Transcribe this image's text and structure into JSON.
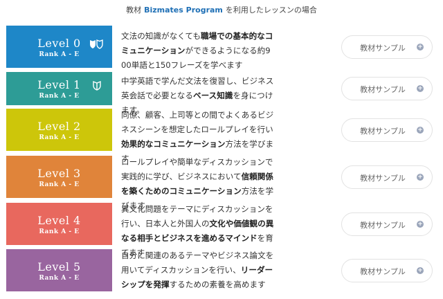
{
  "heading": {
    "prefix": "教材",
    "brand": "Bizmates Program",
    "suffix": "を利用したレッスンの場合"
  },
  "levels": [
    {
      "level": "Level 0",
      "rank": "Rank A - E",
      "color": "#1e87c8",
      "desc": [
        [
          "文法の知識がなくても"
        ],
        [
          "職場での基本的なコミュニケーション",
          true
        ],
        [
          "ができるようになる約900単語と150フレーズを学べます"
        ]
      ],
      "button": "教材サンプル",
      "icon": "double-shield-icon"
    },
    {
      "level": "Level 1",
      "rank": "Rank A - E",
      "color": "#2d9c96",
      "desc": [
        [
          "中学英語で学んだ文法を復習し、ビジネス英会話で必要となる"
        ],
        [
          "ベース知識",
          true
        ],
        [
          "を身につけます。"
        ]
      ],
      "button": "教材サンプル",
      "icon": "shield-icon"
    },
    {
      "level": "Level 2",
      "rank": "Rank A - E",
      "color": "#cdc60a",
      "desc": [
        [
          "同僚、顧客、上司等との間でよくあるビジネスシーンを想定したロールプレイを行い"
        ],
        [
          "効果的なコミュニケーション",
          true
        ],
        [
          "方法を学びます"
        ]
      ],
      "button": "教材サンプル"
    },
    {
      "level": "Level 3",
      "rank": "Rank A - E",
      "color": "#e0843a",
      "desc": [
        [
          "ロールプレイや簡単なディスカッションで実践的に学び、ビジネスにおいて"
        ],
        [
          "信頼関係を築くためのコミュニケーション",
          true
        ],
        [
          "方法を学びます"
        ]
      ],
      "button": "教材サンプル"
    },
    {
      "level": "Level 4",
      "rank": "Rank A - E",
      "color": "#e8685e",
      "desc": [
        [
          "異文化問題をテーマにディスカッションを行い、日本人と外国人の"
        ],
        [
          "文化や価値観の異なる相手とビジネスを進めるマインド",
          true
        ],
        [
          "を育てます"
        ]
      ],
      "button": "教材サンプル"
    },
    {
      "level": "Level 5",
      "rank": "Rank A - E",
      "color": "#99659f",
      "desc": [
        [
          "自分に関連のあるテーマやビジネス論文を用いてディスカッションを行い、"
        ],
        [
          "リーダーシップを発揮",
          true
        ],
        [
          "するための素養を高めます"
        ]
      ],
      "button": "教材サンプル"
    }
  ]
}
